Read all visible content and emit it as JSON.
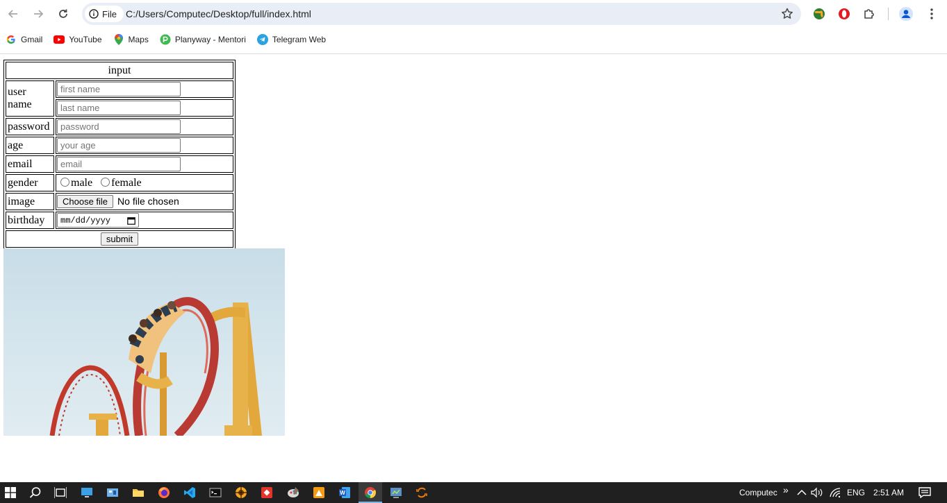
{
  "browser": {
    "omnibox": {
      "scheme_label": "File",
      "url": "C:/Users/Computec/Desktop/full/index.html"
    },
    "bookmarks": [
      {
        "label": "Gmail",
        "icon": "google-icon",
        "color": "#4285f4"
      },
      {
        "label": "YouTube",
        "icon": "youtube-icon",
        "color": "#ff0000"
      },
      {
        "label": "Maps",
        "icon": "maps-icon",
        "color": "#34a853"
      },
      {
        "label": "Planyway - Mentori",
        "icon": "planyway-icon",
        "color": "#3fb950"
      },
      {
        "label": "Telegram Web",
        "icon": "telegram-icon",
        "color": "#2aa3e0"
      }
    ]
  },
  "form": {
    "header": "input",
    "username_label": "user name",
    "first_name_placeholder": "first name",
    "last_name_placeholder": "last name",
    "password_label": "password",
    "password_placeholder": "password",
    "age_label": "age",
    "age_placeholder": "your age",
    "email_label": "email",
    "email_placeholder": "email",
    "gender_label": "gender",
    "gender_options": [
      "male",
      "female"
    ],
    "image_label": "image",
    "choose_file_label": "Choose file",
    "no_file_text": "No file chosen",
    "birthday_label": "birthday",
    "date_placeholder": "mm/dd/yyyy",
    "submit_label": "submit"
  },
  "taskbar": {
    "user_label": "Computec",
    "overflow_label": "»",
    "language": "ENG",
    "time": "2:51 AM"
  }
}
